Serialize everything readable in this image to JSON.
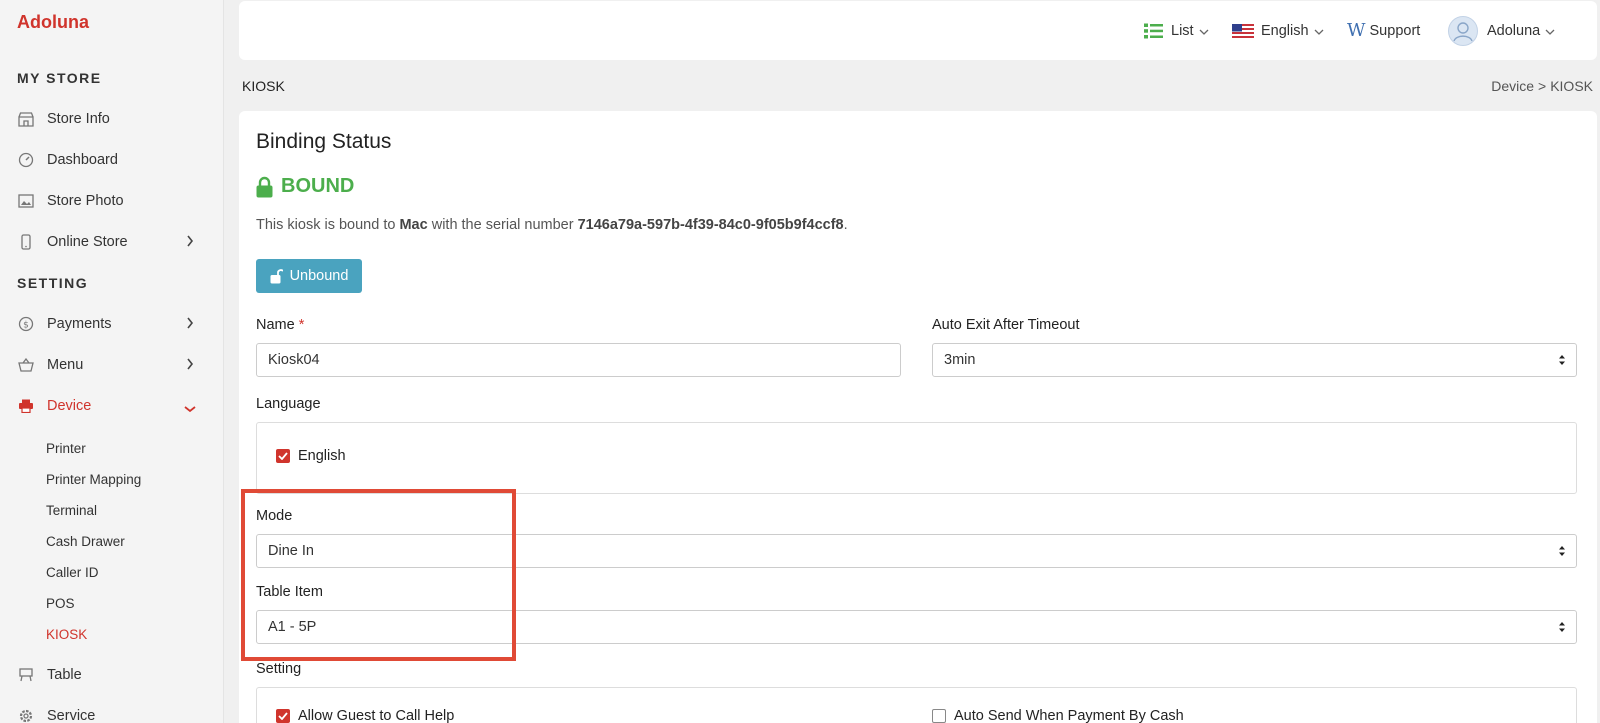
{
  "brand": "Adoluna",
  "sidebar": {
    "section_store": "MY STORE",
    "section_setting": "SETTING",
    "items": [
      {
        "label": "Store Info"
      },
      {
        "label": "Dashboard"
      },
      {
        "label": "Store Photo"
      },
      {
        "label": "Online Store"
      },
      {
        "label": "Payments"
      },
      {
        "label": "Menu"
      },
      {
        "label": "Device"
      },
      {
        "label": "Table"
      },
      {
        "label": "Service"
      }
    ],
    "device_sub": [
      "Printer",
      "Printer Mapping",
      "Terminal",
      "Cash Drawer",
      "Caller ID",
      "POS",
      "KIOSK"
    ]
  },
  "header": {
    "list": "List",
    "language": "English",
    "support": "Support",
    "user": "Adoluna"
  },
  "page": {
    "title": "KIOSK",
    "crumb_parent": "Device",
    "crumb_sep": ">",
    "crumb_current": "KIOSK"
  },
  "card": {
    "title": "Binding Status",
    "status": "BOUND",
    "bind_prefix": "This kiosk is bound to ",
    "bind_device": "Mac",
    "bind_middle": " with the serial number ",
    "bind_serial": "7146a79a-597b-4f39-84c0-9f05b9f4ccf8",
    "bind_suffix": ".",
    "unbound_label": "Unbound"
  },
  "form": {
    "name_label": "Name",
    "name_required": "*",
    "name_value": "Kiosk04",
    "timeout_label": "Auto Exit After Timeout",
    "timeout_value": "3min",
    "language_label": "Language",
    "language_option": "English",
    "mode_label": "Mode",
    "mode_value": "Dine In",
    "table_label": "Table Item",
    "table_value": "A1 - 5P",
    "setting_label": "Setting",
    "setting_call_help": "Allow Guest to Call Help",
    "setting_auto_send": "Auto Send When Payment By Cash"
  },
  "colors": {
    "brand": "#d0342c",
    "bound": "#4cae4c",
    "button": "#4aa3bf",
    "highlight": "#e04a36"
  }
}
